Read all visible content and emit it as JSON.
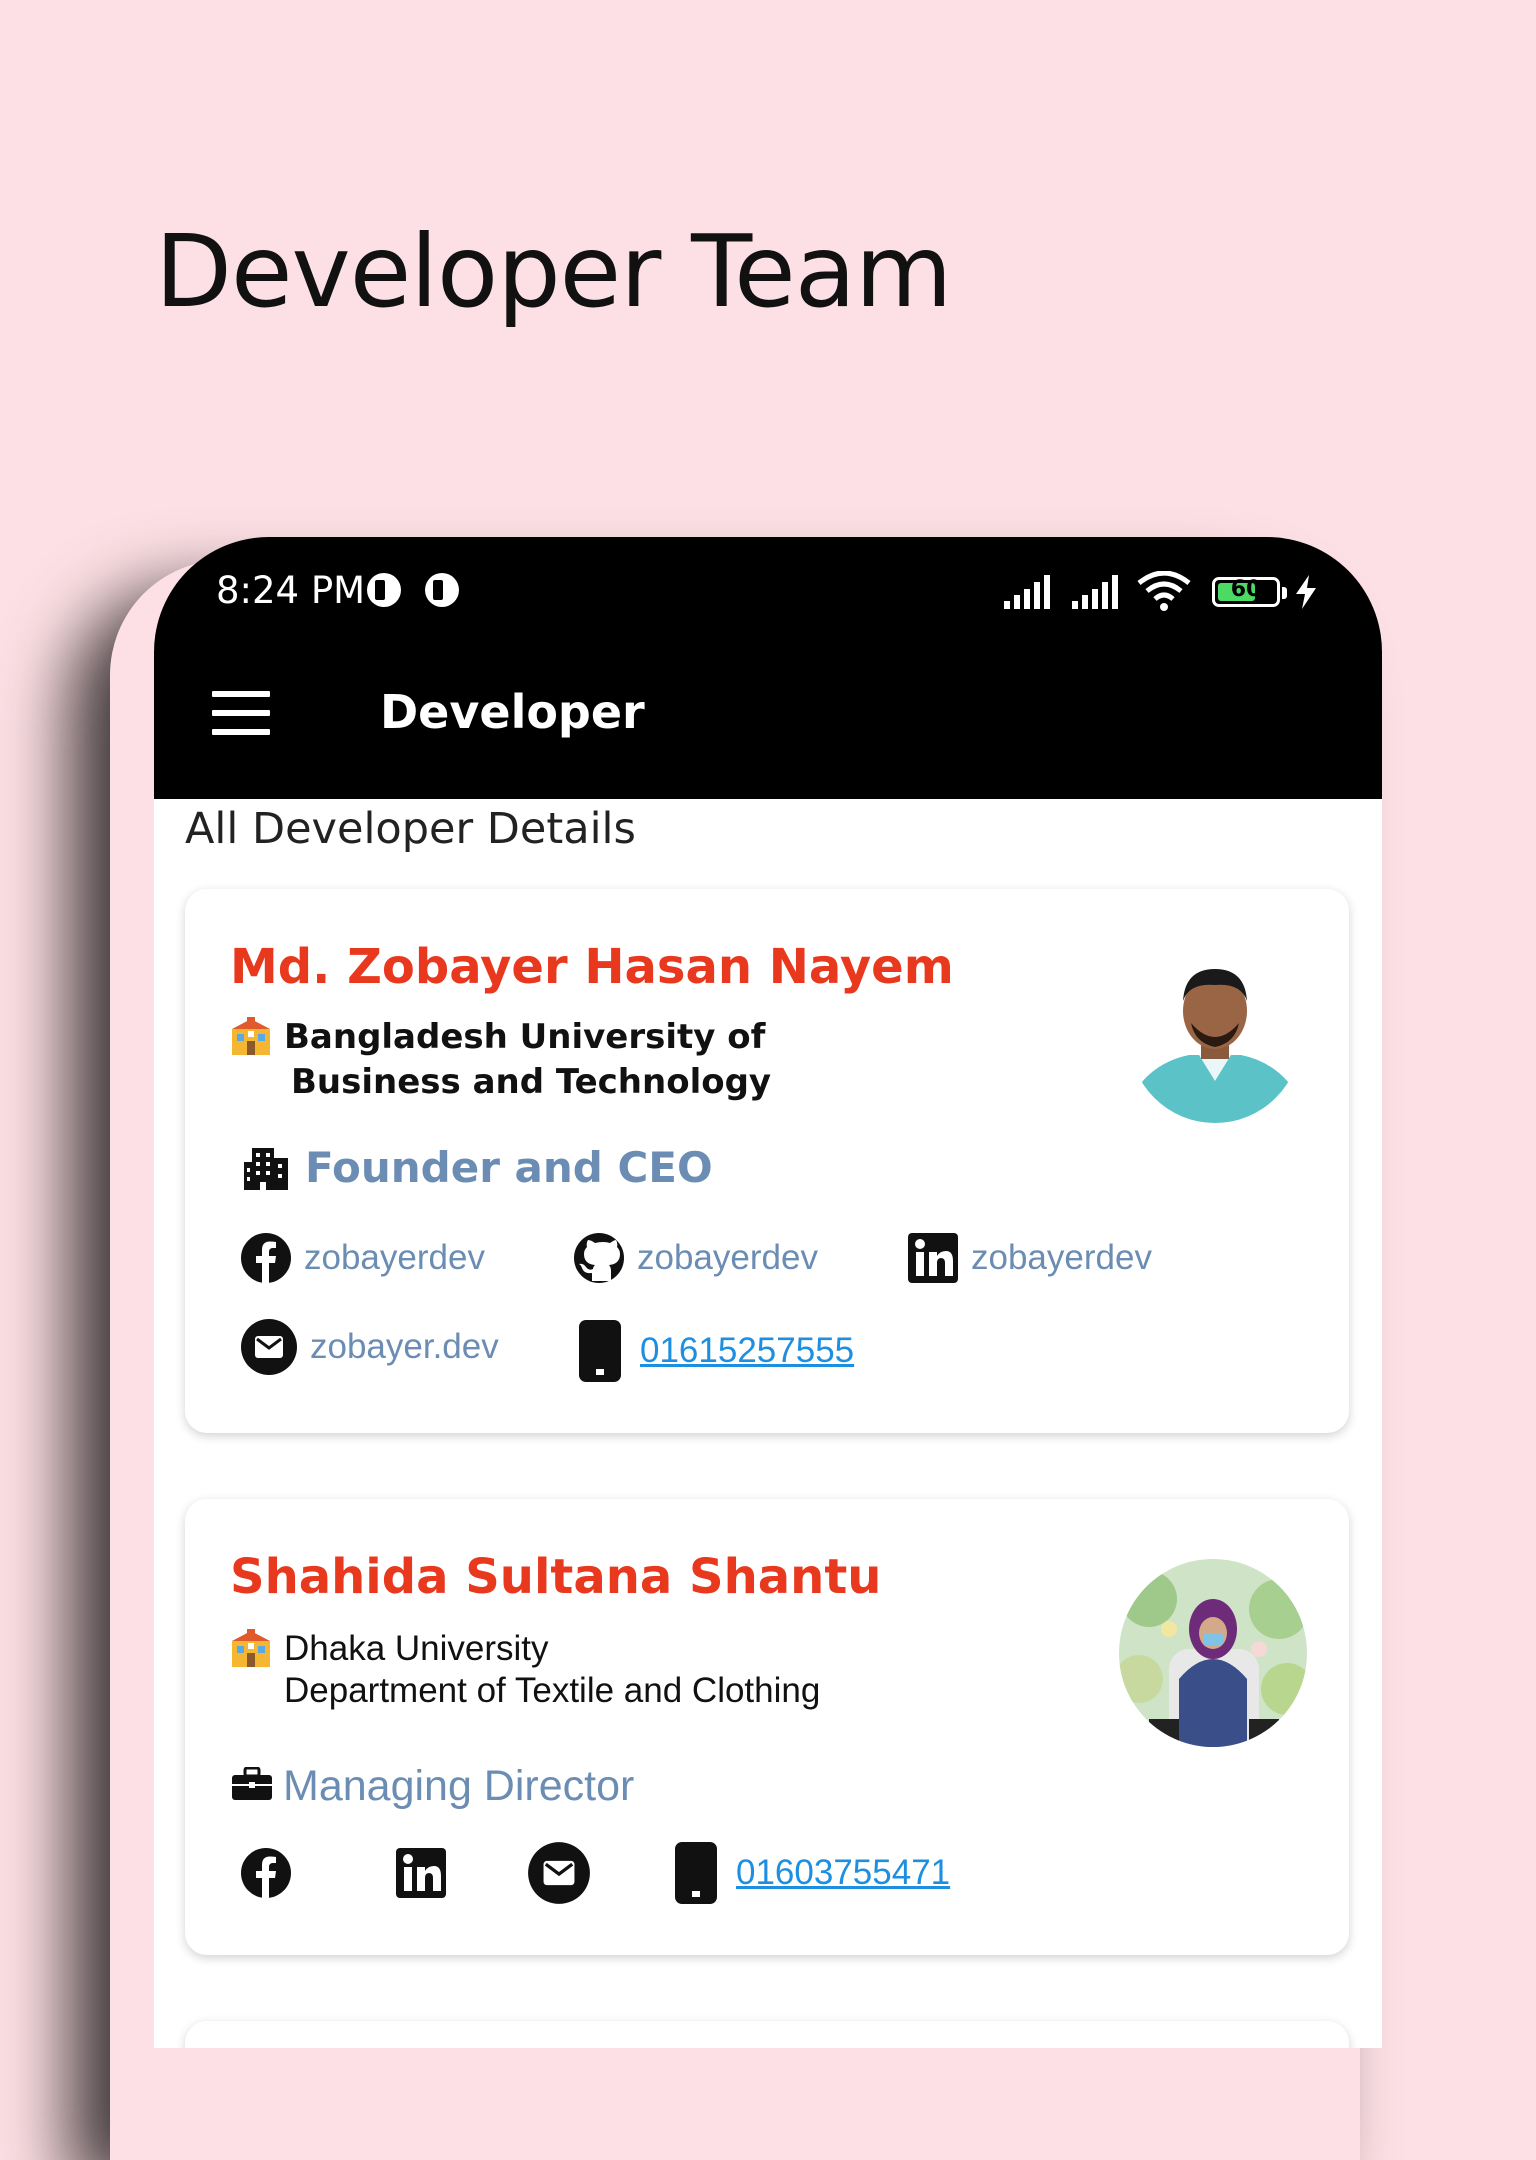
{
  "hero": {
    "title": "Developer Team"
  },
  "status_bar": {
    "time": "8:24 PM",
    "battery": "60"
  },
  "app_bar": {
    "title": "Developer"
  },
  "section_header": "All Developer Details",
  "developers": [
    {
      "name": "Md. Zobayer Hasan Nayem",
      "university_line1": "Bangladesh University of",
      "university_line2": "Business and Technology",
      "role": "Founder and CEO",
      "facebook": "zobayerdev",
      "github": "zobayerdev",
      "linkedin": "zobayerdev",
      "email": "zobayer.dev",
      "phone": "01615257555"
    },
    {
      "name": "Shahida Sultana Shantu",
      "university_line1": "Dhaka University",
      "university_line2": "Department of Textile and Clothing",
      "role": "Managing Director",
      "phone": "01603755471"
    }
  ],
  "colors": {
    "background": "#fde0e5",
    "name": "#e8391f",
    "role": "#6c8db3",
    "link": "#1e8fe0",
    "app_bar": "#000000"
  }
}
